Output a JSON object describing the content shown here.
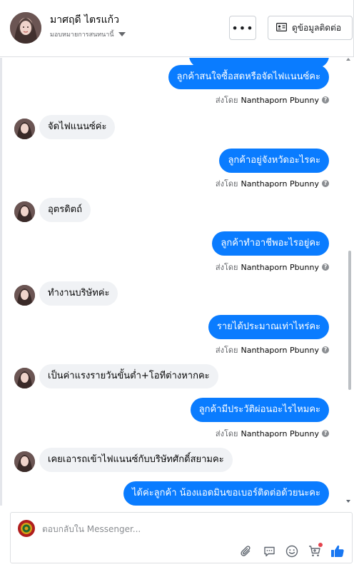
{
  "header": {
    "contact_name": "มาศฤดี ไตรแก้ว",
    "contact_status": "มอบหมายการสนทนานี้",
    "more_label": "•••",
    "contact_info_label": "ดูข้อมูลติดต่อ"
  },
  "messages": [
    {
      "dir": "out",
      "text": "",
      "partial": true
    },
    {
      "dir": "out",
      "text": "ลูกค้าสนใจซื้อสดหรือจัดไฟแนนซ์คะ",
      "sent_prefix": "ส่งโดย",
      "sender": "Nanthaporn Pbunny"
    },
    {
      "dir": "in",
      "text": "จัดไฟแนนซ์ค่ะ"
    },
    {
      "dir": "out",
      "text": "ลูกค้าอยู่จังหวัดอะไรคะ",
      "sent_prefix": "ส่งโดย",
      "sender": "Nanthaporn Pbunny"
    },
    {
      "dir": "in",
      "text": "อุตรดิตถ์"
    },
    {
      "dir": "out",
      "text": "ลูกค้าทำอาชีพอะไรอยู่คะ",
      "sent_prefix": "ส่งโดย",
      "sender": "Nanthaporn Pbunny"
    },
    {
      "dir": "in",
      "text": "ทำงานบริษัทค่ะ"
    },
    {
      "dir": "out",
      "text": "รายได้ประมาณเท่าไหร่คะ",
      "sent_prefix": "ส่งโดย",
      "sender": "Nanthaporn Pbunny"
    },
    {
      "dir": "in",
      "text": "เป็นค่าแรงรายวันขั้นต่ำ+โอทีต่างหากคะ"
    },
    {
      "dir": "out",
      "text": "ลูกค้ามีประวัติผ่อนอะไรไหมคะ",
      "sent_prefix": "ส่งโดย",
      "sender": "Nanthaporn Pbunny"
    },
    {
      "dir": "in",
      "text": "เคยเอารถเข้าไฟแนนซ์กับบริษัทศักดิ์สยามคะ"
    },
    {
      "dir": "out",
      "text": "ได้ค่ะลูกค้า น้องแอดมินขอเบอร์ติดต่อด้วยนะคะ"
    }
  ],
  "composer": {
    "placeholder": "ตอบกลับใน Messenger..."
  },
  "colors": {
    "outgoing_bubble": "#0a7cff",
    "incoming_bubble": "#f0f2f5",
    "like_icon": "#1877f2",
    "notification_dot": "#e4424c"
  },
  "icons": {
    "more": "ellipsis-icon",
    "contact_info": "contact-card-icon",
    "status_dropdown": "caret-down-icon",
    "attach": "paperclip-icon",
    "saved_replies": "speech-bubble-icon",
    "emoji": "smiley-icon",
    "cart": "cart-icon",
    "like": "thumbs-up-icon",
    "help": "question-circle-icon"
  }
}
